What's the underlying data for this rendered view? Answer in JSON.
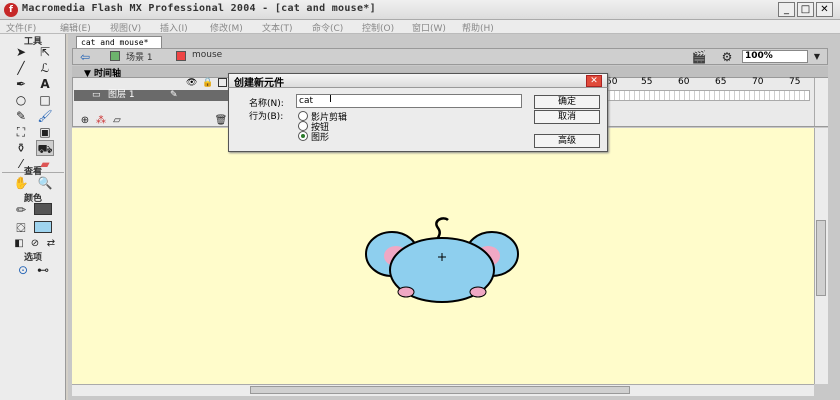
{
  "app": {
    "title": "Macromedia Flash MX Professional 2004 - [cat and mouse*]",
    "logo": "f",
    "window_buttons": [
      "_",
      "□",
      "✕"
    ]
  },
  "menubar": [
    "文件(F)",
    "编辑(E)",
    "视图(V)",
    "插入(I)",
    "修改(M)",
    "文本(T)",
    "命令(C)",
    "控制(O)",
    "窗口(W)",
    "帮助(H)"
  ],
  "toolbar": {
    "tools_label": "工具",
    "view_label": "查看",
    "colors_label": "颜色",
    "options_label": "选项"
  },
  "document": {
    "tab": "cat and mouse*",
    "scene": "场景 1",
    "symbol": "mouse",
    "zoom": "100%",
    "timeline_label": "▼ 时间轴",
    "layer_name": "图层 1",
    "ruler": [
      "50",
      "55",
      "60",
      "65",
      "70",
      "75"
    ]
  },
  "dialog": {
    "title": "创建新元件",
    "name_label": "名称(N):",
    "name_value": "cat",
    "behavior_label": "行为(B):",
    "options": [
      "影片剪辑",
      "按钮",
      "图形"
    ],
    "selected_option": 2,
    "ok": "确定",
    "cancel": "取消",
    "advanced": "高级"
  }
}
